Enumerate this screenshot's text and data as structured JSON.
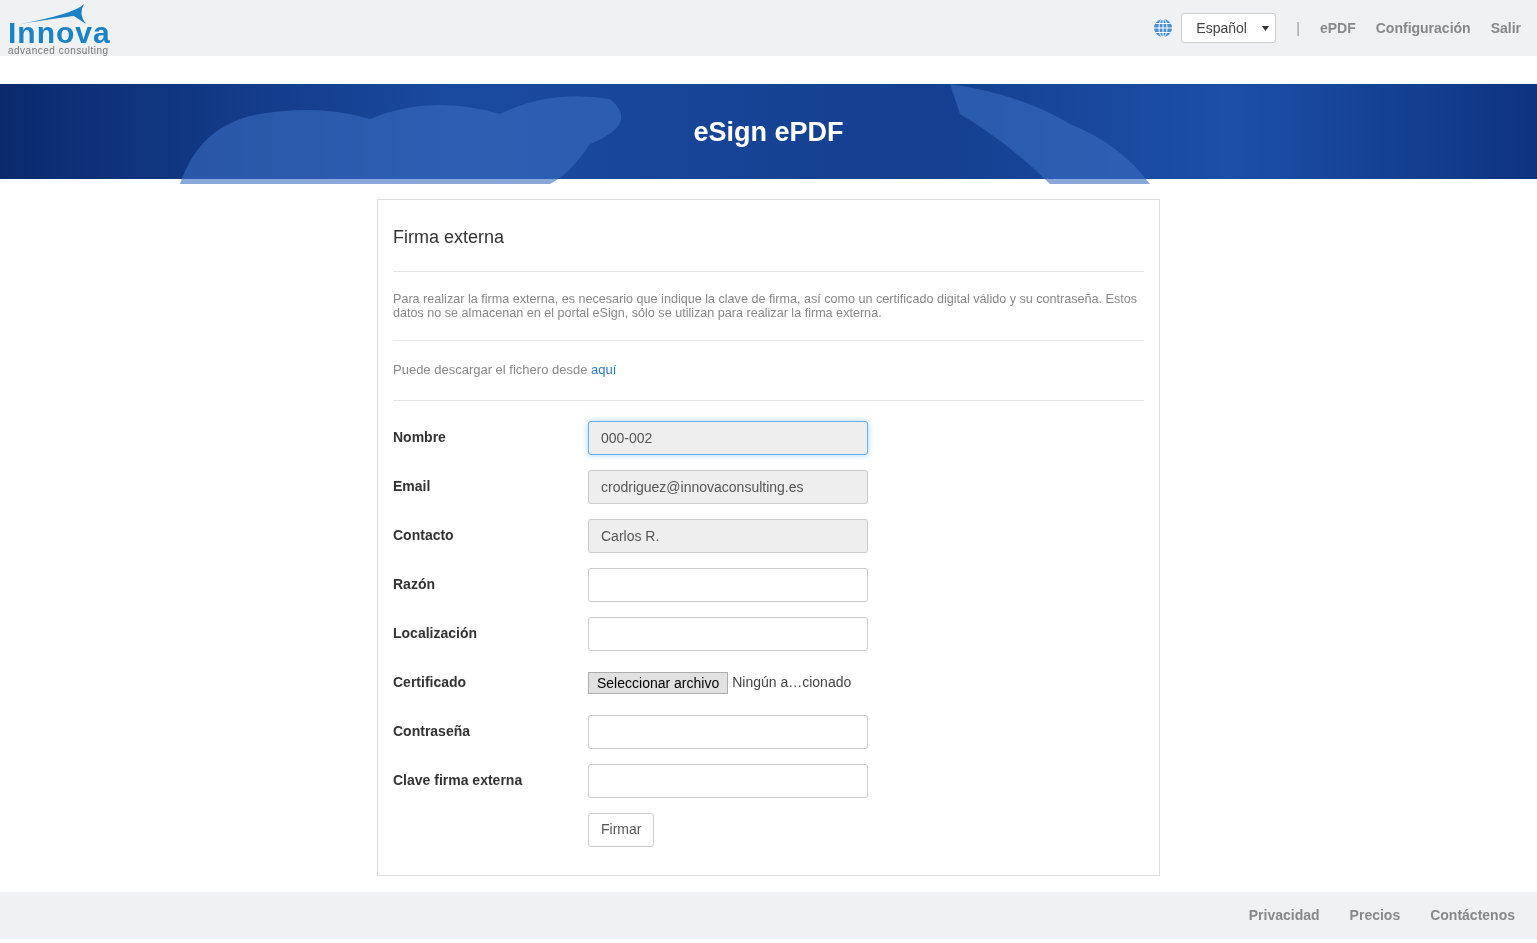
{
  "header": {
    "logo": {
      "name": "Innova",
      "tagline": "advanced consulting"
    },
    "language": "Español",
    "separator": "|",
    "nav": [
      "ePDF",
      "Configuración",
      "Salir"
    ]
  },
  "banner": {
    "title": "eSign ePDF"
  },
  "form": {
    "title": "Firma externa",
    "description": "Para realizar la firma externa, es necesario que indique la clave de firma, así como un certificado digital válido y su contraseña. Estos datos no se almacenan en el portal eSign, sólo se utilizan para realizar la firma externa.",
    "download_text": "Puede descargar el fichero desde",
    "download_link": "aquí",
    "fields": [
      {
        "label": "Nombre",
        "kind": "text",
        "value": "000-002",
        "disabled": true,
        "focused": true
      },
      {
        "label": "Email",
        "kind": "text",
        "value": "crodriguez@innovaconsulting.es",
        "disabled": true,
        "focused": false
      },
      {
        "label": "Contacto",
        "kind": "text",
        "value": "Carlos R.",
        "disabled": true,
        "focused": false
      },
      {
        "label": "Razón",
        "kind": "text",
        "disabled": false,
        "focused": false
      },
      {
        "label": "Localización",
        "kind": "text",
        "disabled": false,
        "focused": false
      },
      {
        "label": "Certificado",
        "kind": "file",
        "button": "Seleccionar archivo",
        "status": "Ningún a…cionado"
      },
      {
        "label": "Contraseña",
        "kind": "password",
        "disabled": false,
        "focused": false
      },
      {
        "label": "Clave firma externa",
        "kind": "text",
        "disabled": false,
        "focused": false
      }
    ],
    "submit": "Firmar"
  },
  "footer": [
    "Privacidad",
    "Precios",
    "Contáctenos"
  ]
}
